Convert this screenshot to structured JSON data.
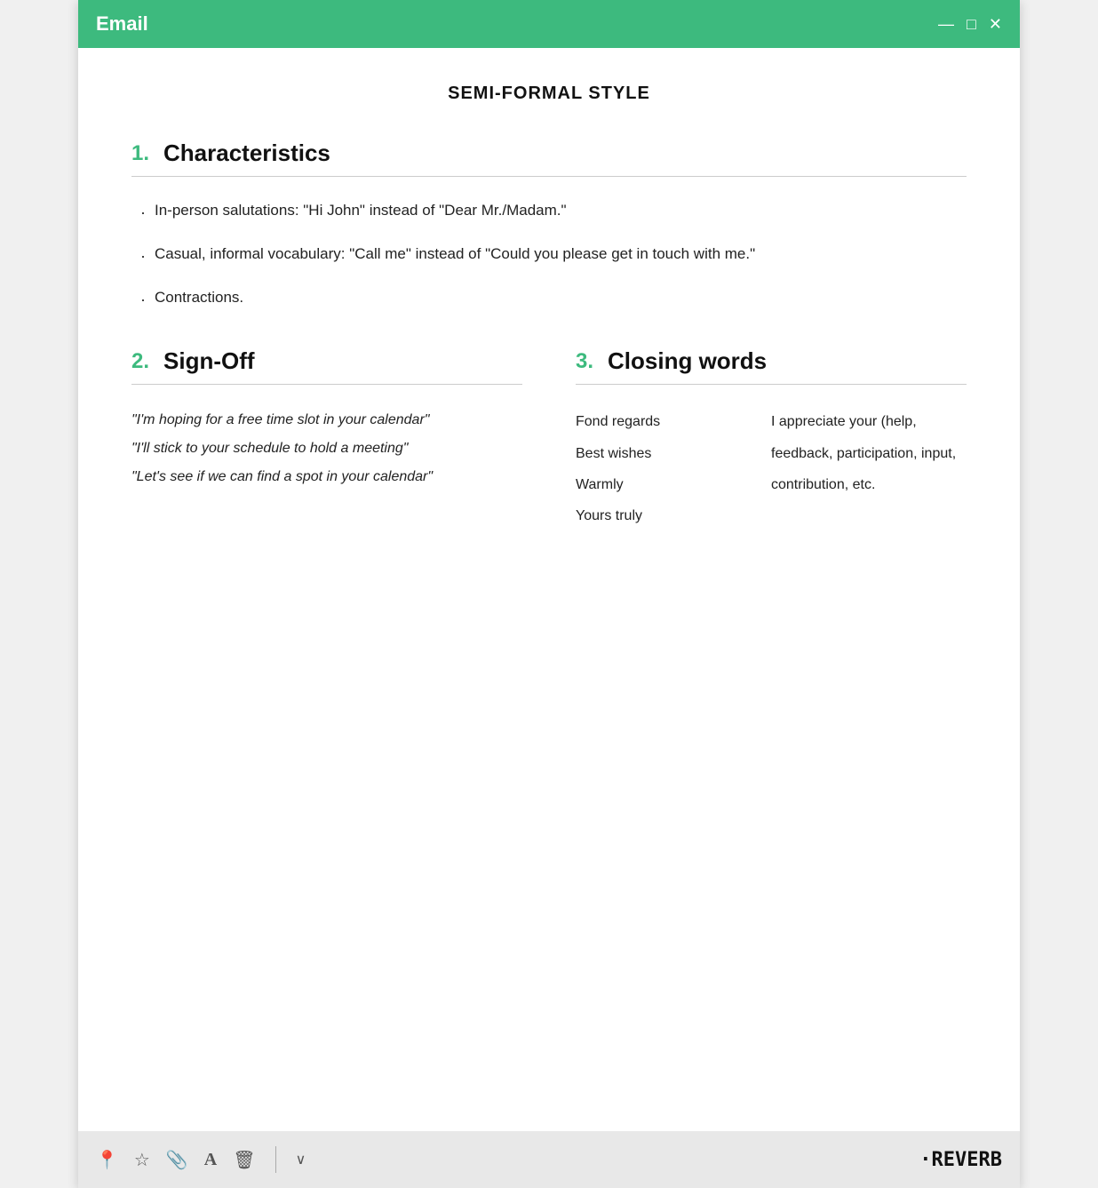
{
  "titlebar": {
    "title": "Email",
    "minimize": "—",
    "maximize": "□",
    "close": "✕"
  },
  "content": {
    "page_title": "SEMI-FORMAL STYLE",
    "section1": {
      "number": "1.",
      "title": "Characteristics",
      "bullets": [
        "In-person salutations: \"Hi John\" instead of \"Dear Mr./Madam.\"",
        "Casual, informal vocabulary: \"Call me\" instead of \"Could you please get in touch with me.\"",
        "Contractions."
      ]
    },
    "section2": {
      "number": "2.",
      "title": "Sign-Off",
      "quotes": [
        "\"I'm hoping for a free time slot in your calendar\"",
        "\"I'll stick to your schedule to hold a meeting\"",
        "\"Let's see if we can find a spot in your calendar\""
      ]
    },
    "section3": {
      "number": "3.",
      "title": "Closing words",
      "left_words": [
        "Fond regards",
        "Best wishes",
        "Warmly",
        "Yours truly"
      ],
      "right_text": "I appreciate your (help, feedback, participation, input, contribution, etc."
    }
  },
  "toolbar": {
    "icons": [
      "📍",
      "☆",
      "📎",
      "A",
      "🗑"
    ],
    "dropdown": "∨",
    "brand": "·REVERB"
  }
}
